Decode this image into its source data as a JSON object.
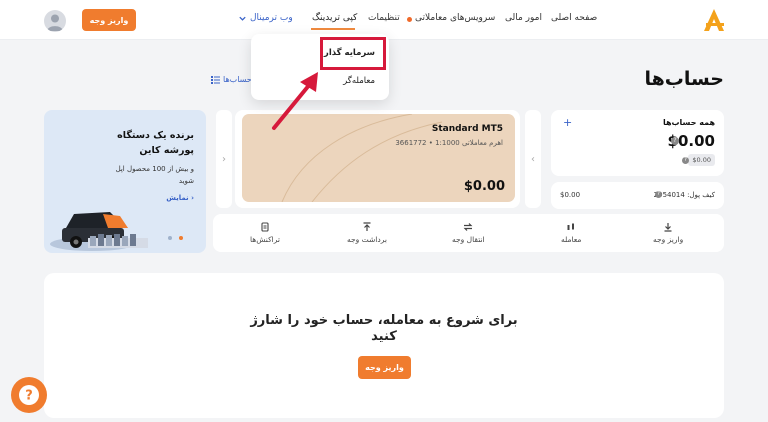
{
  "colors": {
    "accent": "#f07c2e",
    "link": "#3a63c8",
    "highlight": "#d6193b",
    "mt5_card": "#ecd5bd",
    "promo_bg": "#dde8f6"
  },
  "header": {
    "nav": {
      "home": "صفحه اصلی",
      "finance": "امور مالی",
      "trading_services": "سرویس‌های معاملاتی",
      "settings": "تنظیمات",
      "copy_trading": "کپی تریدینگ",
      "web_terminal": "وب ترمینال"
    },
    "deposit_button": "واریز وجه",
    "logo_icon": "brand-logo-icon",
    "avatar_icon": "user-avatar-icon"
  },
  "dropdown": {
    "items": [
      "سرمایه گذار",
      "معامله‌گر"
    ]
  },
  "page": {
    "title": "حساب‌ها",
    "accounts_link": "حساب‌ها"
  },
  "summary": {
    "label": "همه حساب‌ها",
    "add_icon": "+",
    "balance": "$0.00",
    "sub_balance": "$0.00"
  },
  "wallet": {
    "label": "کیف پول: 2954014",
    "value": "$0.00"
  },
  "mt5": {
    "name": "Standard MT5",
    "details": "3661772 • اهرم معاملاتی 1:1000",
    "balance": "$0.00"
  },
  "promo": {
    "title_line1": "برنده یک دستگاه",
    "title_line2": "پورشه کاین",
    "subtitle_line1": "و بیش از 100 محصول اپل",
    "subtitle_line2": "شوید",
    "show_link": "نمایش"
  },
  "actions": [
    {
      "label": "واریز وجه",
      "icon": "download-icon"
    },
    {
      "label": "معامله",
      "icon": "trade-icon"
    },
    {
      "label": "انتقال وجه",
      "icon": "transfer-icon"
    },
    {
      "label": "برداشت وجه",
      "icon": "upload-icon"
    },
    {
      "label": "تراکنش‌ها",
      "icon": "transactions-icon"
    }
  ],
  "empty_state": {
    "line1": "برای شروع به معامله، حساب خود را شارژ",
    "line2": "کنید",
    "button": "واریز وجه"
  },
  "help_icon": "help-icon"
}
